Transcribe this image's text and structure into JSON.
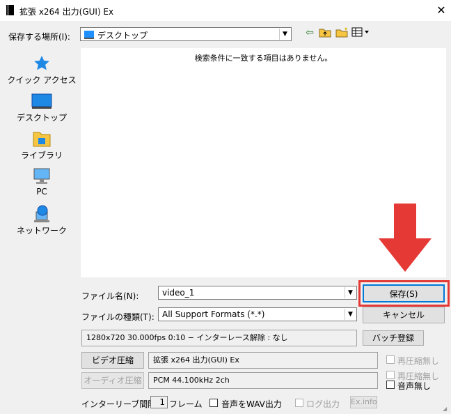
{
  "window": {
    "title": "拡張 x264 出力(GUI) Ex",
    "close_glyph": "✕"
  },
  "location": {
    "label": "保存する場所(I):",
    "value": "デスクトップ"
  },
  "places": [
    {
      "label": "クイック アクセス",
      "icon": "star-icon"
    },
    {
      "label": "デスクトップ",
      "icon": "desktop-icon"
    },
    {
      "label": "ライブラリ",
      "icon": "library-folder-icon"
    },
    {
      "label": "PC",
      "icon": "computer-icon"
    },
    {
      "label": "ネットワーク",
      "icon": "network-icon"
    }
  ],
  "file_list": {
    "empty_message": "検索条件に一致する項目はありません。"
  },
  "filename": {
    "label": "ファイル名(N):",
    "value": "video_1"
  },
  "filetype": {
    "label": "ファイルの種類(T):",
    "value": "All Support Formats (*.*)"
  },
  "buttons": {
    "save": "保存(S)",
    "cancel": "キャンセル",
    "batch": "バッチ登録",
    "video_compress": "ビデオ圧縮",
    "audio_compress": "オーディオ圧縮",
    "exinfo": "Ex.info"
  },
  "info": {
    "summary": "1280x720  30.000fps  0:10  −  インターレース解除 : なし",
    "video_codec": "拡張 x264 出力(GUI) Ex",
    "audio_codec": "PCM 44.100kHz 2ch"
  },
  "options": {
    "no_recompress_video": "再圧縮無し",
    "no_recompress_audio": "再圧縮無し",
    "no_audio": "音声無し",
    "interleave_label": "インターリーブ間隔 :",
    "interleave_value": "1",
    "interleave_unit": "フレーム",
    "wav_output": "音声をWAV出力",
    "log_output": "ログ出力"
  },
  "colors": {
    "highlight": "#e53935",
    "arrow": "#e53935"
  }
}
